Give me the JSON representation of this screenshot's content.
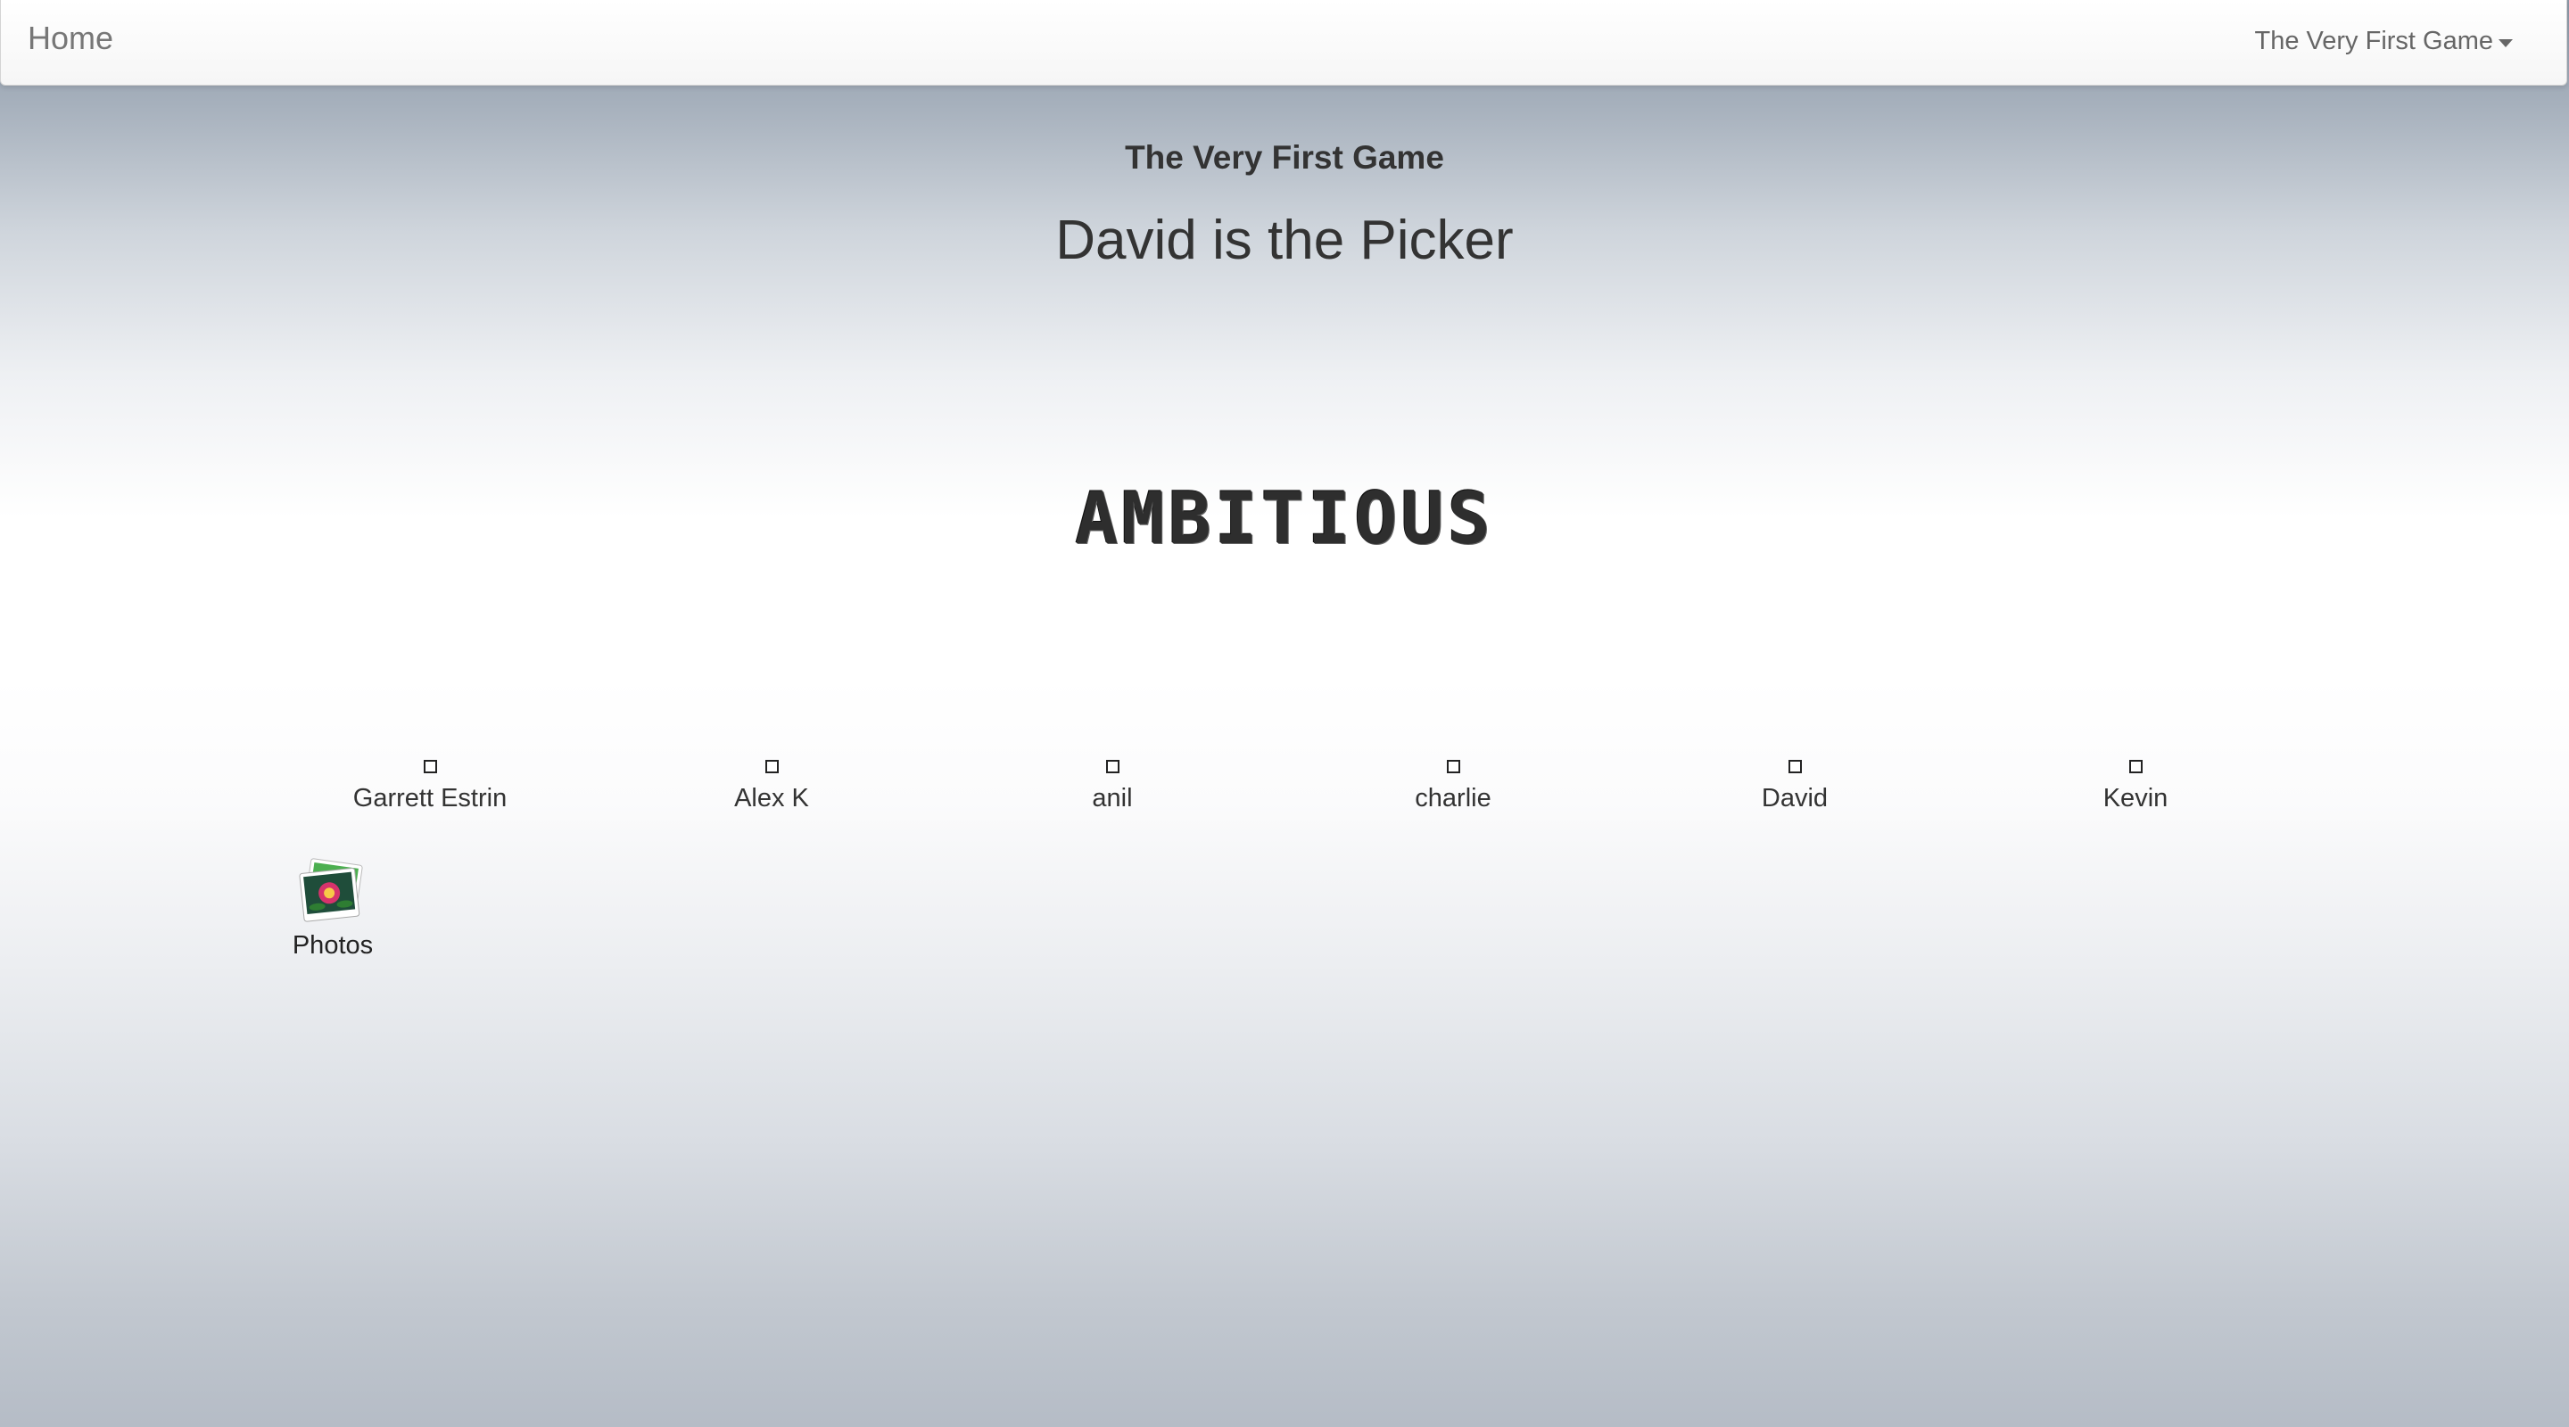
{
  "navbar": {
    "brand": "Home",
    "game_menu": "The Very First Game"
  },
  "main": {
    "game_name": "The Very First Game",
    "picker_text": "David is the Picker",
    "word": "AMBITIOUS"
  },
  "players": [
    {
      "name": "Garrett Estrin",
      "checked": false
    },
    {
      "name": "Alex K",
      "checked": false
    },
    {
      "name": "anil",
      "checked": false
    },
    {
      "name": "charlie",
      "checked": false
    },
    {
      "name": "David",
      "checked": false
    },
    {
      "name": "Kevin",
      "checked": false
    }
  ],
  "desktop": {
    "photos_label": "Photos",
    "photos_icon": "photos-icon"
  }
}
